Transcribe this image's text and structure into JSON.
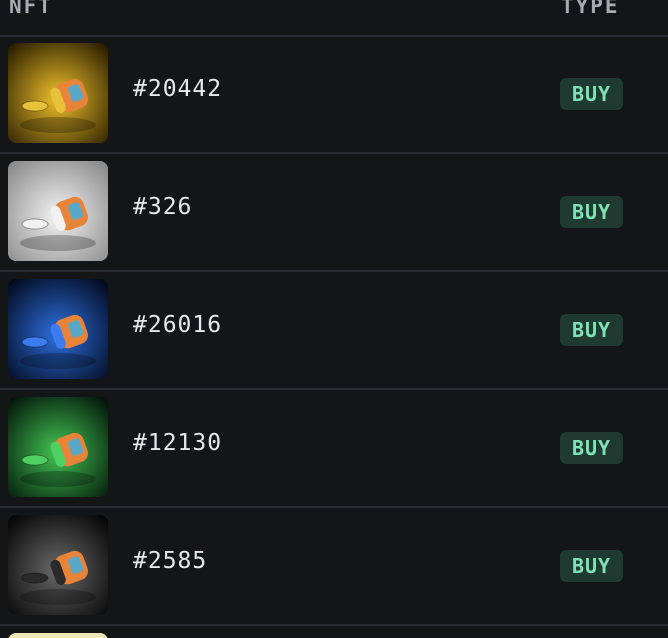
{
  "header": {
    "nft_label": "NFT",
    "type_label": "TYPE"
  },
  "rows": [
    {
      "id": "#20442",
      "type": "BUY",
      "bg_center": "#f0c12a",
      "bg_edge": "#2a1e00",
      "lid": "#e8c23a",
      "icon": "jar-icon"
    },
    {
      "id": "#326",
      "type": "BUY",
      "bg_center": "#f4f4f4",
      "bg_edge": "#8a8a8a",
      "lid": "#f2f2f2",
      "icon": "jar-icon"
    },
    {
      "id": "#26016",
      "type": "BUY",
      "bg_center": "#2e6fe0",
      "bg_edge": "#020a1e",
      "lid": "#3b7cf0",
      "icon": "jar-icon"
    },
    {
      "id": "#12130",
      "type": "BUY",
      "bg_center": "#43c654",
      "bg_edge": "#03160a",
      "lid": "#4fd062",
      "icon": "jar-icon"
    },
    {
      "id": "#2585",
      "type": "BUY",
      "bg_center": "#6a6a6a",
      "bg_edge": "#050505",
      "lid": "#2a2a2a",
      "icon": "jar-icon"
    }
  ],
  "colors": {
    "background": "#131517",
    "divider": "#2a2d31",
    "badge_bg": "#1f3a30",
    "badge_text": "#7fe3b6"
  }
}
